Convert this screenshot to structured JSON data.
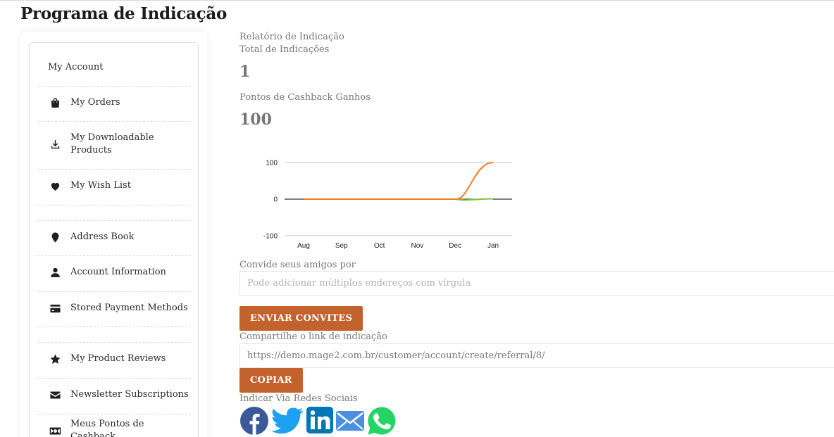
{
  "page": {
    "title": "Programa de Indicação"
  },
  "sidebar": {
    "items": [
      {
        "label": "My Account",
        "icon": "none"
      },
      {
        "label": "My Orders",
        "icon": "shopping-bag-icon"
      },
      {
        "label": "My Downloadable Products",
        "icon": "download-icon"
      },
      {
        "label": "My Wish List",
        "icon": "heart-icon"
      },
      {
        "label": "Address Book",
        "icon": "map-pin-icon"
      },
      {
        "label": "Account Information",
        "icon": "user-icon"
      },
      {
        "label": "Stored Payment Methods",
        "icon": "credit-card-icon"
      },
      {
        "label": "My Product Reviews",
        "icon": "star-icon"
      },
      {
        "label": "Newsletter Subscriptions",
        "icon": "envelope-icon"
      },
      {
        "label": "Meus Pontos de Cashback",
        "icon": "money-bill-icon"
      }
    ]
  },
  "report": {
    "heading": "Relatório de Indicação",
    "total_label": "Total de Indicações",
    "total_value": "1",
    "points_label": "Pontos de Cashback Ganhos",
    "points_value": "100"
  },
  "chart_data": {
    "type": "line",
    "categories": [
      "Aug",
      "Sep",
      "Oct",
      "Nov",
      "Dec",
      "Jan"
    ],
    "ylim": [
      -100,
      100
    ],
    "yticks": [
      "100",
      "0",
      "-100"
    ],
    "series": [
      {
        "values": [
          0,
          0,
          0,
          0,
          0,
          1
        ],
        "color": "#7ec241"
      },
      {
        "values": [
          0,
          0,
          0,
          0,
          0,
          100
        ],
        "color": "#ef7d22"
      }
    ],
    "title": "",
    "xlabel": "",
    "ylabel": ""
  },
  "invite": {
    "label": "Convide seus amigos por",
    "placeholder": "Pode adicionar múltiplos endereços com vírgula",
    "button": "ENVIAR CONVITES"
  },
  "share": {
    "label": "Compartilhe o link de indicação",
    "link": "https://demo.mage2.com.br/customer/account/create/referral/8/",
    "button": "COPIAR"
  },
  "social": {
    "label": "Indicar Via Redes Sociais",
    "networks": [
      {
        "name": "facebook-icon",
        "color": "#3b5998"
      },
      {
        "name": "twitter-icon",
        "color": "#1da1f2"
      },
      {
        "name": "linkedin-icon",
        "color": "#0077b5"
      },
      {
        "name": "email-icon",
        "color": "#4b8fe2"
      },
      {
        "name": "whatsapp-icon",
        "color": "#25d366"
      }
    ]
  },
  "colors": {
    "accent": "#c4622d"
  }
}
